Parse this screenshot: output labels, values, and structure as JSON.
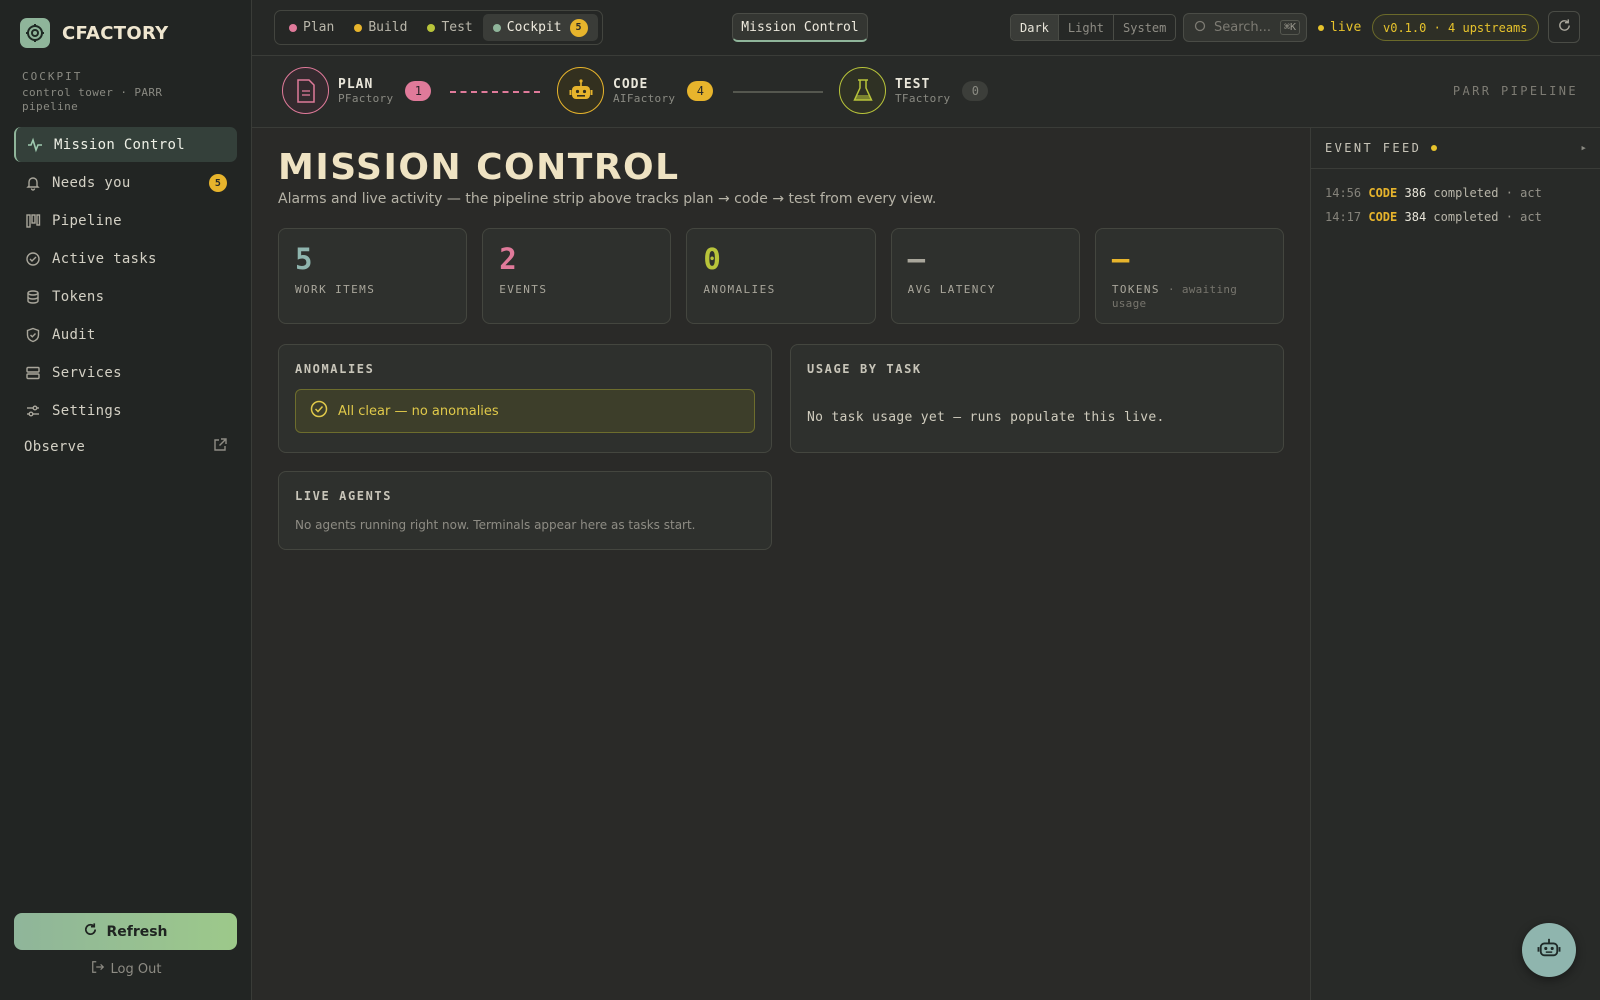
{
  "brand": {
    "name": "CFACTORY"
  },
  "sidebar": {
    "section_label": "COCKPIT",
    "section_sub": "control tower · PARR pipeline",
    "items": [
      {
        "label": "Mission Control",
        "icon": "pulse-icon",
        "active": true
      },
      {
        "label": "Needs you",
        "icon": "bell-icon",
        "badge": "5"
      },
      {
        "label": "Pipeline",
        "icon": "kanban-icon"
      },
      {
        "label": "Active tasks",
        "icon": "check-circle-icon"
      },
      {
        "label": "Tokens",
        "icon": "database-icon"
      },
      {
        "label": "Audit",
        "icon": "shield-check-icon"
      },
      {
        "label": "Services",
        "icon": "server-icon"
      },
      {
        "label": "Settings",
        "icon": "sliders-icon"
      }
    ],
    "observe_label": "Observe",
    "refresh_label": "Refresh",
    "logout_label": "Log Out"
  },
  "topbar": {
    "crumbs": [
      {
        "label": "Plan",
        "color": "#e07a9a"
      },
      {
        "label": "Build",
        "color": "#e7b42c"
      },
      {
        "label": "Test",
        "color": "#b8c43a"
      },
      {
        "label": "Cockpit",
        "color": "#8fb59a",
        "badge": "5",
        "active": true
      }
    ],
    "active_tab": "Mission Control",
    "theme_options": [
      "Dark",
      "Light",
      "System"
    ],
    "theme_selected": "Dark",
    "search_placeholder": "Search...",
    "search_shortcut": "⌘K",
    "live_label": "live",
    "version_label": "v0.1.0 · 4 upstreams"
  },
  "pipeline": {
    "label": "PARR PIPELINE",
    "stages": [
      {
        "name": "PLAN",
        "sub": "PFactory",
        "count": "1",
        "color": "#e07a9a"
      },
      {
        "name": "CODE",
        "sub": "AIFactory",
        "count": "4",
        "color": "#e7b42c"
      },
      {
        "name": "TEST",
        "sub": "TFactory",
        "count": "0",
        "color": "#b8c43a"
      }
    ]
  },
  "main": {
    "title": "MISSION CONTROL",
    "subtitle": "Alarms and live activity — the pipeline strip above tracks plan → code → test from every view.",
    "stats": [
      {
        "value": "5",
        "label": "WORK ITEMS",
        "color": "#8fb5ae"
      },
      {
        "value": "2",
        "label": "EVENTS",
        "color": "#e07a9a"
      },
      {
        "value": "0",
        "label": "ANOMALIES",
        "color": "#b8c43a"
      },
      {
        "value": "—",
        "label": "AVG LATENCY",
        "color": "#a9a69b"
      },
      {
        "value": "—",
        "label": "TOKENS",
        "label_note": "· awaiting usage",
        "color": "#e7b42c"
      }
    ],
    "anomalies": {
      "title": "ANOMALIES",
      "message": "All clear — no anomalies"
    },
    "usage": {
      "title": "USAGE BY TASK",
      "message": "No task usage yet — runs populate this live."
    },
    "agents": {
      "title": "LIVE AGENTS",
      "message": "No agents running right now. Terminals appear here as tasks start."
    }
  },
  "feed": {
    "title": "EVENT FEED",
    "toggle": "▸",
    "events": [
      {
        "time": "14:56",
        "kind": "CODE",
        "id": "386",
        "status": "completed",
        "actor": "· act"
      },
      {
        "time": "14:17",
        "kind": "CODE",
        "id": "384",
        "status": "completed",
        "actor": "· act"
      }
    ]
  }
}
